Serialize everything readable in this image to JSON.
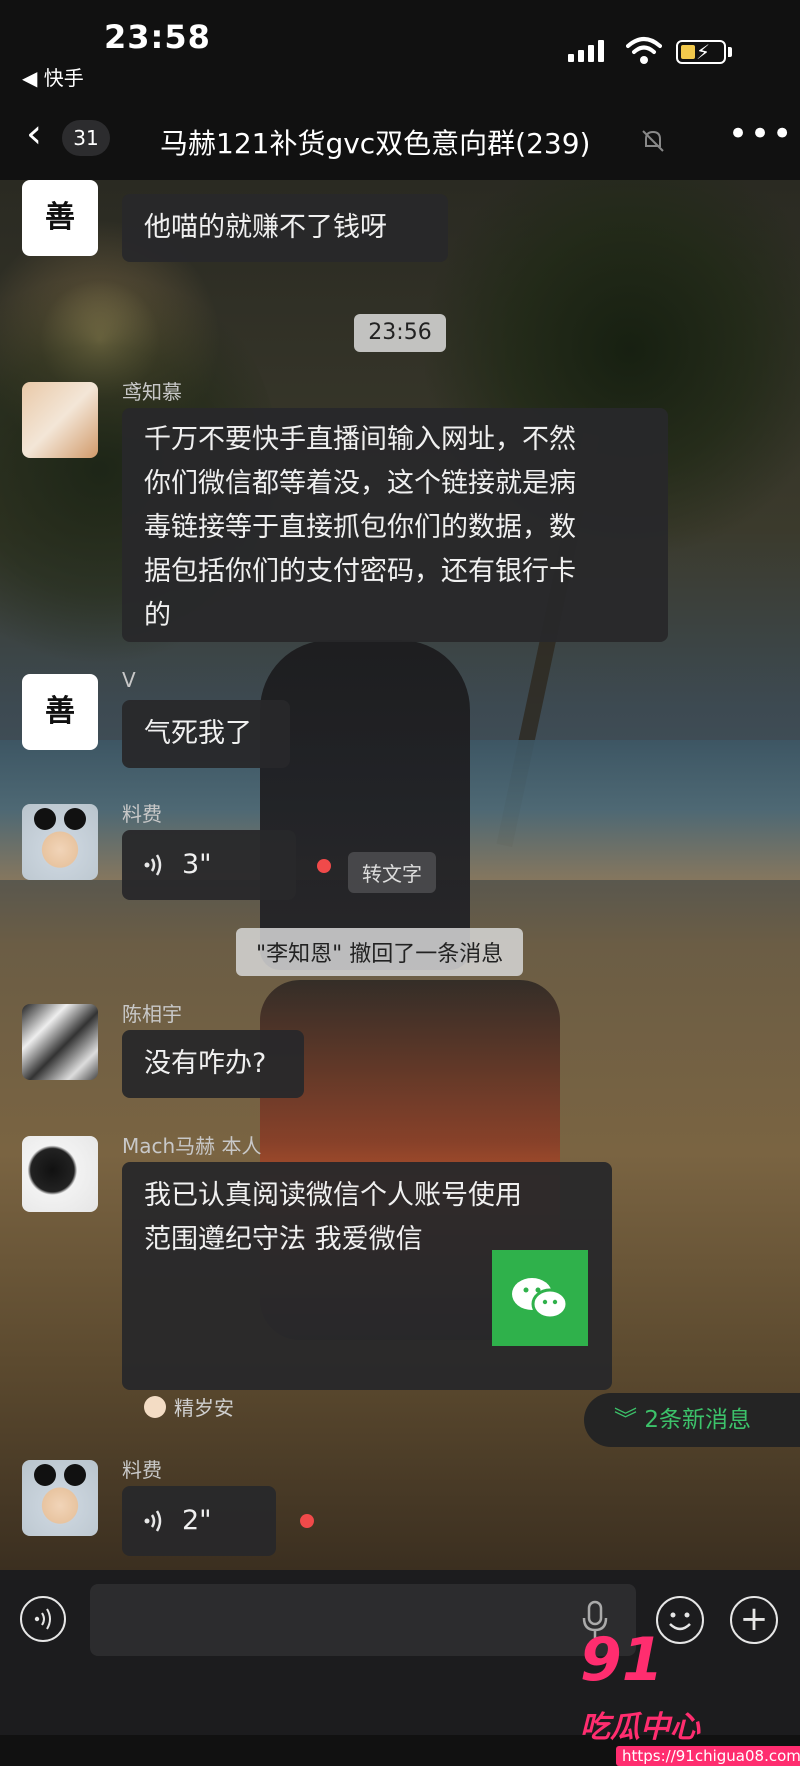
{
  "status_bar": {
    "time": "23:58",
    "back_app": "◀ 快手"
  },
  "nav": {
    "unread_count": "31",
    "title": "马赫121补货gvc双色意向群(239)"
  },
  "messages": [
    {
      "avatar_text": "善",
      "sender": "",
      "text": "他喵的就赚不了钱呀"
    },
    {
      "time_chip": "23:56"
    },
    {
      "sender": "鸢知慕",
      "lines": [
        "千万不要快手直播间输入网址，不然",
        "你们微信都等着没，这个链接就是病",
        "毒链接等于直接抓包你们的数据，数",
        "据包括你们的支付密码，还有银行卡",
        "的"
      ]
    },
    {
      "avatar_text": "善",
      "sender": "V",
      "text": "气死我了"
    },
    {
      "sender": "料费",
      "voice_duration": "3\"",
      "to_text": "转文字"
    },
    {
      "system": "\"李知恩\" 撤回了一条消息"
    },
    {
      "sender": "陈相宇",
      "text": "没有咋办?"
    },
    {
      "sender": "Mach马赫 本人",
      "lines": [
        "我已认真阅读微信个人账号使用",
        "范围遵纪守法 我爱微信"
      ],
      "quote_name": "精岁安"
    },
    {
      "sender": "料费",
      "voice_duration": "2\""
    }
  ],
  "new_messages_label": "2条新消息",
  "watermark": {
    "number": "91",
    "name": "吃瓜中心",
    "url": "https://91chigua08.com"
  },
  "icons": {
    "back": "chevron-left-icon",
    "mute": "bell-slash-icon",
    "more": "more-dots-icon",
    "voice_mode": "voice-mode-icon",
    "mic": "mic-icon",
    "emoji": "emoji-icon",
    "plus": "plus-icon"
  },
  "colors": {
    "accent_green": "#3cc26a",
    "record_dot": "#f04a4a",
    "wechat_green": "#2fb14b",
    "watermark_pink": "#ff2d6f"
  }
}
